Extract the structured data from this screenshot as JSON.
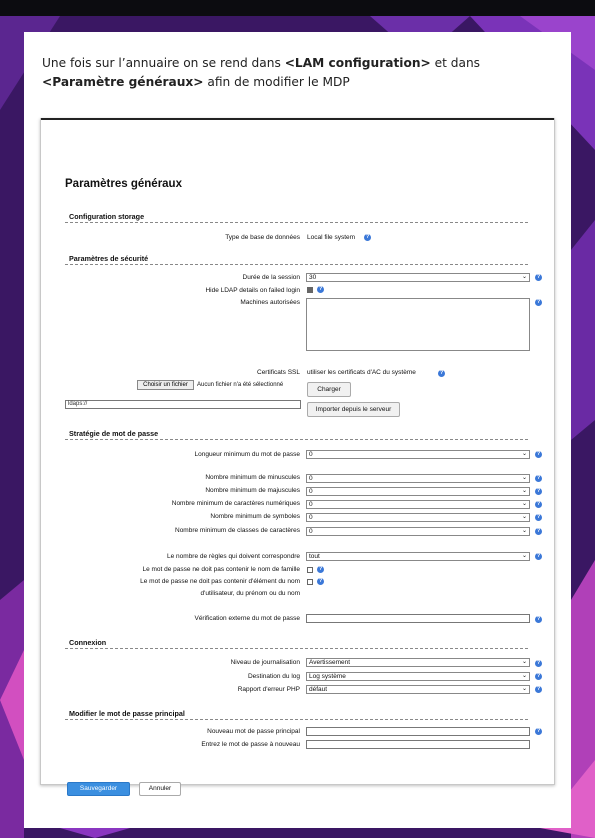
{
  "colors": {
    "background": "#3a1763",
    "accent": "#3b8fe0",
    "help": "#3b78d8"
  },
  "intro": {
    "part1": "Une fois sur l’annuaire on se rend dans ",
    "bold1": "<LAM configuration>",
    "part2": " et dans ",
    "bold2": "<Paramètre généraux>",
    "part3": " afin de modifier le MDP"
  },
  "page_title": "Paramètres généraux",
  "storage": {
    "heading": "Configuration storage",
    "db_type_label": "Type de base de données",
    "db_type_value": "Local file system"
  },
  "security": {
    "heading": "Paramètres de sécurité",
    "session_label": "Durée de la session",
    "session_value": "30",
    "hide_ldap_label": "Hide LDAP details on failed login",
    "allowed_hosts_label": "Machines autorisées",
    "ssl_label": "Certificats SSL",
    "ssl_value": "utiliser les certificats d'AC du système",
    "file_button": "Choisir un fichier",
    "file_status": "Aucun fichier n'a été sélectionné",
    "upload_button": "Charger",
    "ldaps_value": "ldaps://",
    "import_button": "Importer depuis le serveur"
  },
  "password_policy": {
    "heading": "Stratégie de mot de passe",
    "min_length_label": "Longueur minimum du mot de passe",
    "min_length_value": "0",
    "rows": [
      {
        "label": "Nombre minimum de minuscules",
        "value": "0"
      },
      {
        "label": "Nombre minimum de majuscules",
        "value": "0"
      },
      {
        "label": "Nombre minimum de caractères numériques",
        "value": "0"
      },
      {
        "label": "Nombre minimum de symboles",
        "value": "0"
      },
      {
        "label": "Nombre minimum de classes de caractères",
        "value": "0"
      }
    ],
    "rules_label": "Le nombre de règles qui doivent correspondre",
    "rules_value": "tout",
    "no_lastname_label": "Le mot de passe ne doit pas contenir le nom de famille",
    "no_user_parts_label_1": "Le mot de passe ne doit pas contenir d'élément du nom",
    "no_user_parts_label_2": "d'utilisateur, du prénom ou du nom",
    "external_check_label": "Vérification externe du mot de passe"
  },
  "connection": {
    "heading": "Connexion",
    "log_level_label": "Niveau de journalisation",
    "log_level_value": "Avertissement",
    "log_dest_label": "Destination du log",
    "log_dest_value": "Log système",
    "php_error_label": "Rapport d'erreur PHP",
    "php_error_value": "défaut"
  },
  "master_password": {
    "heading": "Modifier le mot de passe principal",
    "new_label": "Nouveau mot de passe principal",
    "repeat_label": "Entrez le mot de passe à nouveau"
  },
  "buttons": {
    "save": "Sauvegarder",
    "cancel": "Annuler"
  },
  "help_glyph": "?"
}
